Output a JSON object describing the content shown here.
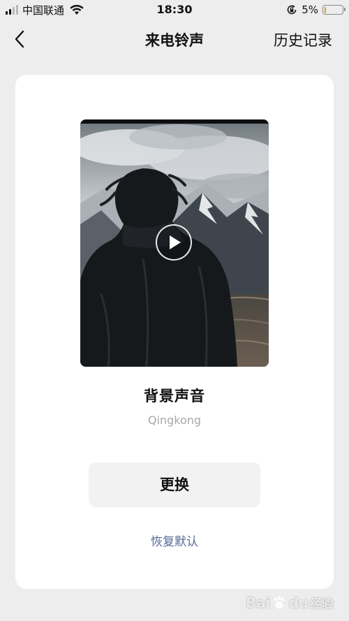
{
  "status_bar": {
    "carrier": "中国联通",
    "time": "18:30",
    "battery_percent": "5%",
    "battery_level": 0.05,
    "icons": [
      "signal-icon",
      "wifi-icon",
      "rotation-lock-icon",
      "battery-icon"
    ]
  },
  "nav": {
    "title": "来电铃声",
    "history_label": "历史记录",
    "back_icon": "chevron-left-icon"
  },
  "ringtone": {
    "title": "背景声音",
    "subtitle": "Qingkong",
    "play_icon": "play-icon"
  },
  "actions": {
    "change_label": "更换",
    "restore_label": "恢复默认"
  },
  "watermark": {
    "brand_a": "Bai",
    "brand_b": "经验",
    "brand_b_suffix": "du"
  },
  "colors": {
    "background": "#ededed",
    "card": "#ffffff",
    "link": "#576b95",
    "button": "#f2f2f2",
    "subtitle": "#a8a8a8"
  }
}
